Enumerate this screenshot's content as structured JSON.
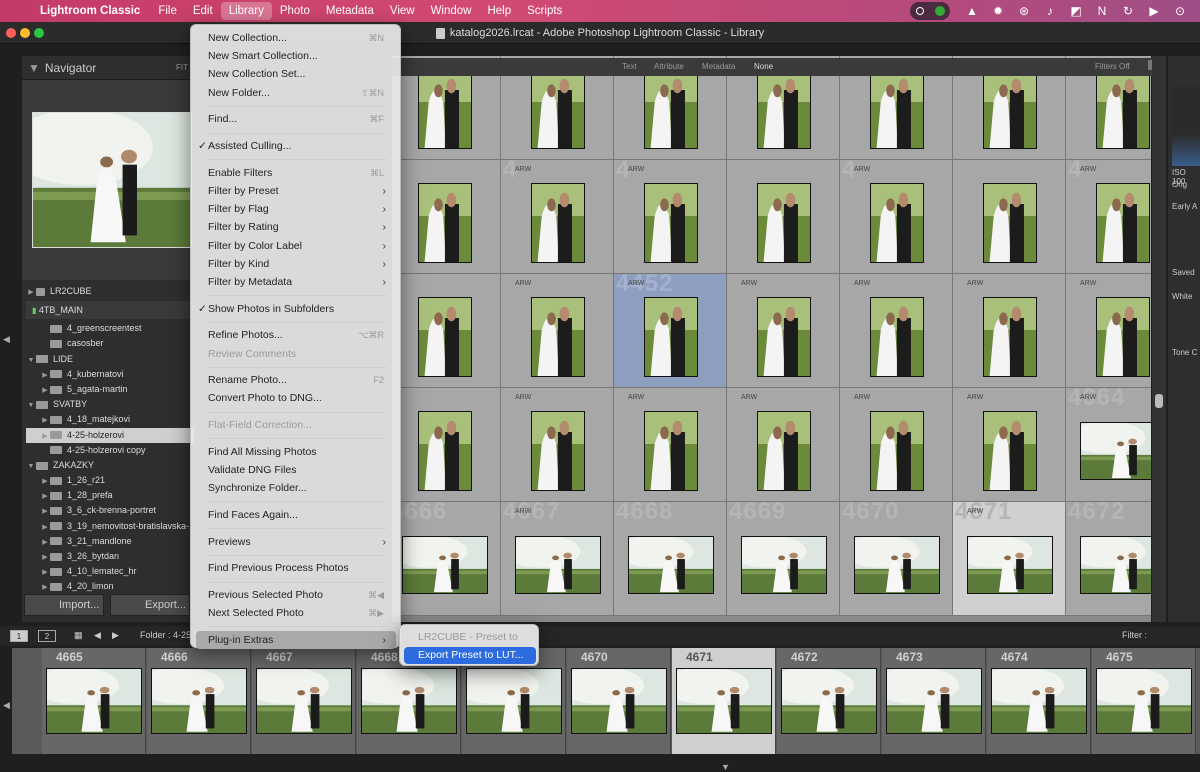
{
  "menubar": {
    "app": "Lightroom Classic",
    "items": [
      "File",
      "Edit",
      "Library",
      "Photo",
      "Metadata",
      "View",
      "Window",
      "Help",
      "Scripts"
    ],
    "selected": "Library"
  },
  "window": {
    "title": "katalog2026.lrcat - Adobe Photoshop Lightroom Classic - Library"
  },
  "navigator": {
    "title": "Navigator",
    "zoom": "FIT"
  },
  "folders": {
    "drive_top": "LR2CUBE",
    "drive_main": "4TB_MAIN",
    "items": [
      {
        "label": "4_greenscreentest",
        "indent": 1,
        "arrow": ""
      },
      {
        "label": "casosber",
        "indent": 1,
        "arrow": ""
      },
      {
        "label": "LIDE",
        "indent": 0,
        "arrow": "▼"
      },
      {
        "label": "4_kubernatovi",
        "indent": 1,
        "arrow": "▶"
      },
      {
        "label": "5_agata-martin",
        "indent": 1,
        "arrow": "▶"
      },
      {
        "label": "SVATBY",
        "indent": 0,
        "arrow": "▼"
      },
      {
        "label": "4_18_matejkovi",
        "indent": 1,
        "arrow": "▶"
      },
      {
        "label": "4-25-holzerovi",
        "indent": 1,
        "arrow": "▶"
      },
      {
        "label": "4-25-holzerovi copy",
        "indent": 1,
        "arrow": ""
      },
      {
        "label": "ZAKAZKY",
        "indent": 0,
        "arrow": "▼"
      },
      {
        "label": "1_26_r21",
        "indent": 1,
        "arrow": "▶"
      },
      {
        "label": "1_28_prefa",
        "indent": 1,
        "arrow": "▶"
      },
      {
        "label": "3_6_ck-brenna-portret",
        "indent": 1,
        "arrow": "▶"
      },
      {
        "label": "3_19_nemovitost-bratislavska-...",
        "indent": 1,
        "arrow": "▶"
      },
      {
        "label": "3_21_mandlone",
        "indent": 1,
        "arrow": "▶"
      },
      {
        "label": "3_26_bytdan",
        "indent": 1,
        "arrow": "▶"
      },
      {
        "label": "4_10_lematec_hr",
        "indent": 1,
        "arrow": "▶"
      },
      {
        "label": "4_20_limon",
        "indent": 1,
        "arrow": "▶"
      }
    ]
  },
  "buttons": {
    "import": "Import...",
    "export": "Export..."
  },
  "filterbar": {
    "text": "Text",
    "attribute": "Attribute",
    "metadata": "Metadata",
    "none": "None",
    "filters_off": "Filters Off"
  },
  "grid": {
    "rows": [
      {
        "nums": [
          "",
          "",
          "",
          "",
          "",
          "",
          ""
        ],
        "exts": [
          "",
          "",
          "",
          "",
          "",
          "",
          ""
        ]
      },
      {
        "nums": [
          "",
          "4",
          "4",
          "",
          "4",
          "",
          "4"
        ],
        "exts": [
          "",
          "ARW",
          "ARW",
          "",
          "ARW",
          "",
          "ARW"
        ]
      },
      {
        "nums": [
          "",
          "",
          "4452",
          "",
          "",
          "",
          ""
        ],
        "exts": [
          "",
          "ARW",
          "ARW",
          "ARW",
          "ARW",
          "ARW",
          "ARW"
        ]
      },
      {
        "nums": [
          "",
          "",
          "",
          "",
          "",
          "",
          "4664"
        ],
        "exts": [
          "",
          "ARW",
          "ARW",
          "ARW",
          "ARW",
          "ARW",
          "ARW"
        ]
      },
      {
        "nums": [
          "4666",
          "4667",
          "4668",
          "4669",
          "4670",
          "4671",
          "4672"
        ],
        "exts": [
          "",
          "ARW",
          "",
          "",
          "",
          "ARW",
          ""
        ]
      }
    ]
  },
  "rightpanel": {
    "iso": "ISO 100",
    "orig": "Orig",
    "early": "Early A",
    "saved": "Saved",
    "white": "White",
    "tone": "Tone C"
  },
  "filmstrip_toolbar": {
    "mon1": "1",
    "mon2": "2",
    "folder": "Folder : 4-25",
    "filter": "Filter :"
  },
  "filmstrip": [
    "4665",
    "4666",
    "4667",
    "4668",
    "4669",
    "4670",
    "4671",
    "4672",
    "4673",
    "4674",
    "4675"
  ],
  "menu": {
    "items": [
      {
        "label": "New Collection...",
        "shortcut": "⌘N"
      },
      {
        "label": "New Smart Collection...",
        "shortcut": ""
      },
      {
        "label": "New Collection Set...",
        "shortcut": ""
      },
      {
        "label": "New Folder...",
        "shortcut": "⇧⌘N"
      },
      {
        "sep": true
      },
      {
        "label": "Find...",
        "shortcut": "⌘F"
      },
      {
        "sep": true
      },
      {
        "label": "Assisted Culling...",
        "check": "✓"
      },
      {
        "sep": true
      },
      {
        "label": "Enable Filters",
        "shortcut": "⌘L"
      },
      {
        "label": "Filter by Preset",
        "sub": true
      },
      {
        "label": "Filter by Flag",
        "sub": true
      },
      {
        "label": "Filter by Rating",
        "sub": true
      },
      {
        "label": "Filter by Color Label",
        "sub": true
      },
      {
        "label": "Filter by Kind",
        "sub": true
      },
      {
        "label": "Filter by Metadata",
        "sub": true
      },
      {
        "sep": true
      },
      {
        "label": "Show Photos in Subfolders",
        "check": "✓"
      },
      {
        "sep": true
      },
      {
        "label": "Refine Photos...",
        "shortcut": "⌥⌘R"
      },
      {
        "label": "Review Comments",
        "disabled": true
      },
      {
        "sep": true
      },
      {
        "label": "Rename Photo...",
        "shortcut": "F2"
      },
      {
        "label": "Convert Photo to DNG..."
      },
      {
        "sep": true
      },
      {
        "label": "Flat-Field Correction...",
        "disabled": true
      },
      {
        "sep": true
      },
      {
        "label": "Find All Missing Photos"
      },
      {
        "label": "Validate DNG Files"
      },
      {
        "label": "Synchronize Folder..."
      },
      {
        "sep": true
      },
      {
        "label": "Find Faces Again..."
      },
      {
        "sep": true
      },
      {
        "label": "Previews",
        "sub": true
      },
      {
        "sep": true
      },
      {
        "label": "Find Previous Process Photos"
      },
      {
        "sep": true
      },
      {
        "label": "Previous Selected Photo",
        "shortcut": "⌘◀"
      },
      {
        "label": "Next Selected Photo",
        "shortcut": "⌘▶"
      },
      {
        "sep": true
      },
      {
        "label": "Plug-in Extras",
        "sub": true,
        "highlight": true
      }
    ]
  },
  "submenu": {
    "items": [
      {
        "label": "LR2CUBE - Preset to LUT",
        "disabled": true
      },
      {
        "label": "Export Preset to LUT...",
        "highlight": true
      }
    ]
  }
}
